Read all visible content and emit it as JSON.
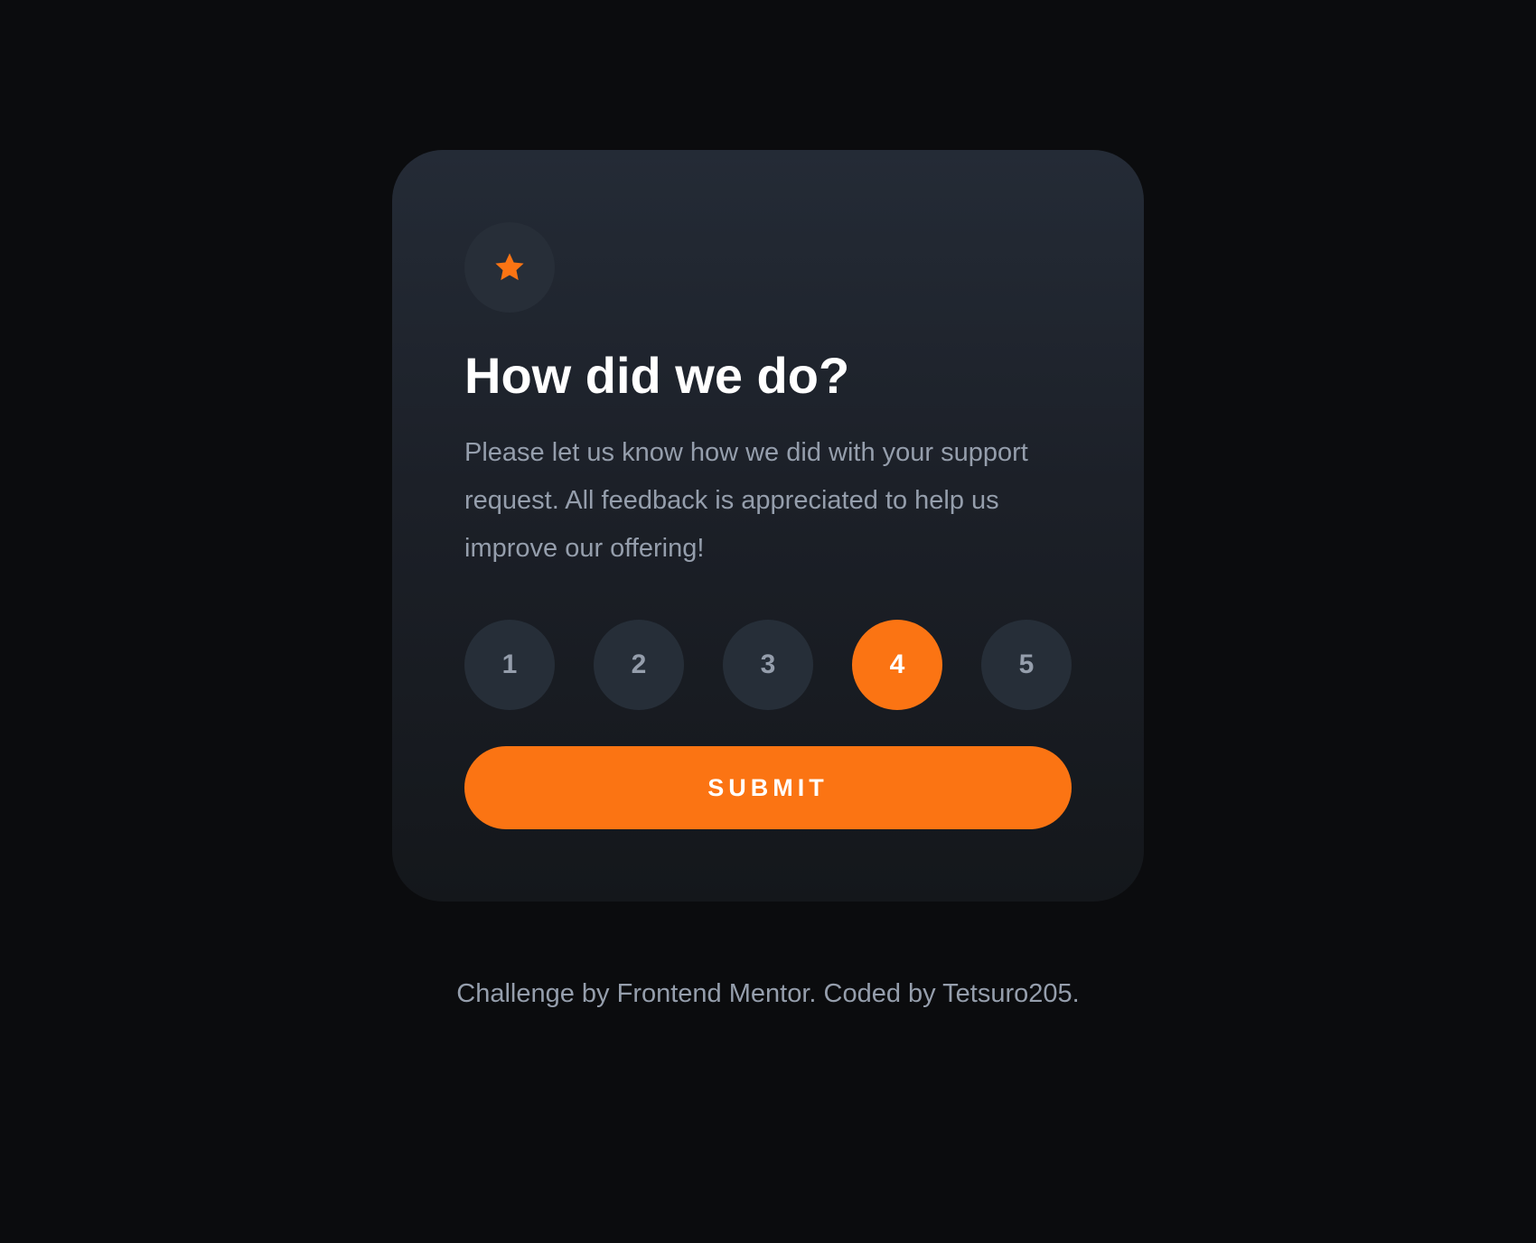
{
  "card": {
    "icon": "star-icon",
    "title": "How did we do?",
    "description": "Please let us know how we did with your support request. All feedback is appreciated to help us improve our offering!",
    "ratings": [
      "1",
      "2",
      "3",
      "4",
      "5"
    ],
    "selected_rating": "4",
    "submit_label": "SUBMIT"
  },
  "footer": {
    "attribution": "Challenge by Frontend Mentor. Coded by Tetsuro205."
  },
  "colors": {
    "background": "#0b0c0e",
    "accent": "#fb7413",
    "card_top": "#242b36",
    "card_bottom": "#14171b",
    "rating_bg": "#262e38",
    "muted_text": "#959eac"
  }
}
